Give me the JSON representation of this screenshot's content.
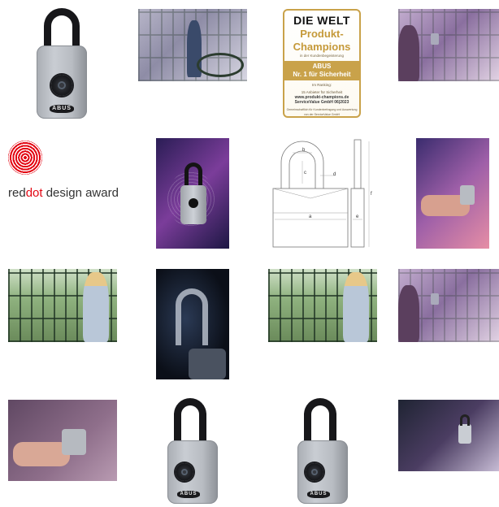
{
  "award": {
    "header": "DIE WELT",
    "title_line1": "Produkt-",
    "title_line2": "Champions",
    "subtitle": "in der Kundenbegeisterung",
    "brand": "ABUS",
    "ribbon_line2": "Nr. 1 für Sicherheit",
    "ranking_line1": "Im Ranking:",
    "ranking_line2": "15 Anbieter für Sicherheit",
    "url": "www.produkt-champions.de",
    "issuer_date": "ServiceValue GmbH   06|2023",
    "fineprint": "Gemeinschaftlich für Kundenbefragung und Auswertung\nvon der ServiceValue GmbH"
  },
  "reddot": {
    "part1": "red",
    "part2": "dot",
    "part3": " design award"
  },
  "lock_brand": "ABUS",
  "drawing_labels": {
    "a": "a",
    "b": "b",
    "c": "c",
    "d": "d",
    "e": "e",
    "f": "f"
  },
  "colors": {
    "reddot_red": "#e30613",
    "award_gold": "#c9a24a"
  }
}
